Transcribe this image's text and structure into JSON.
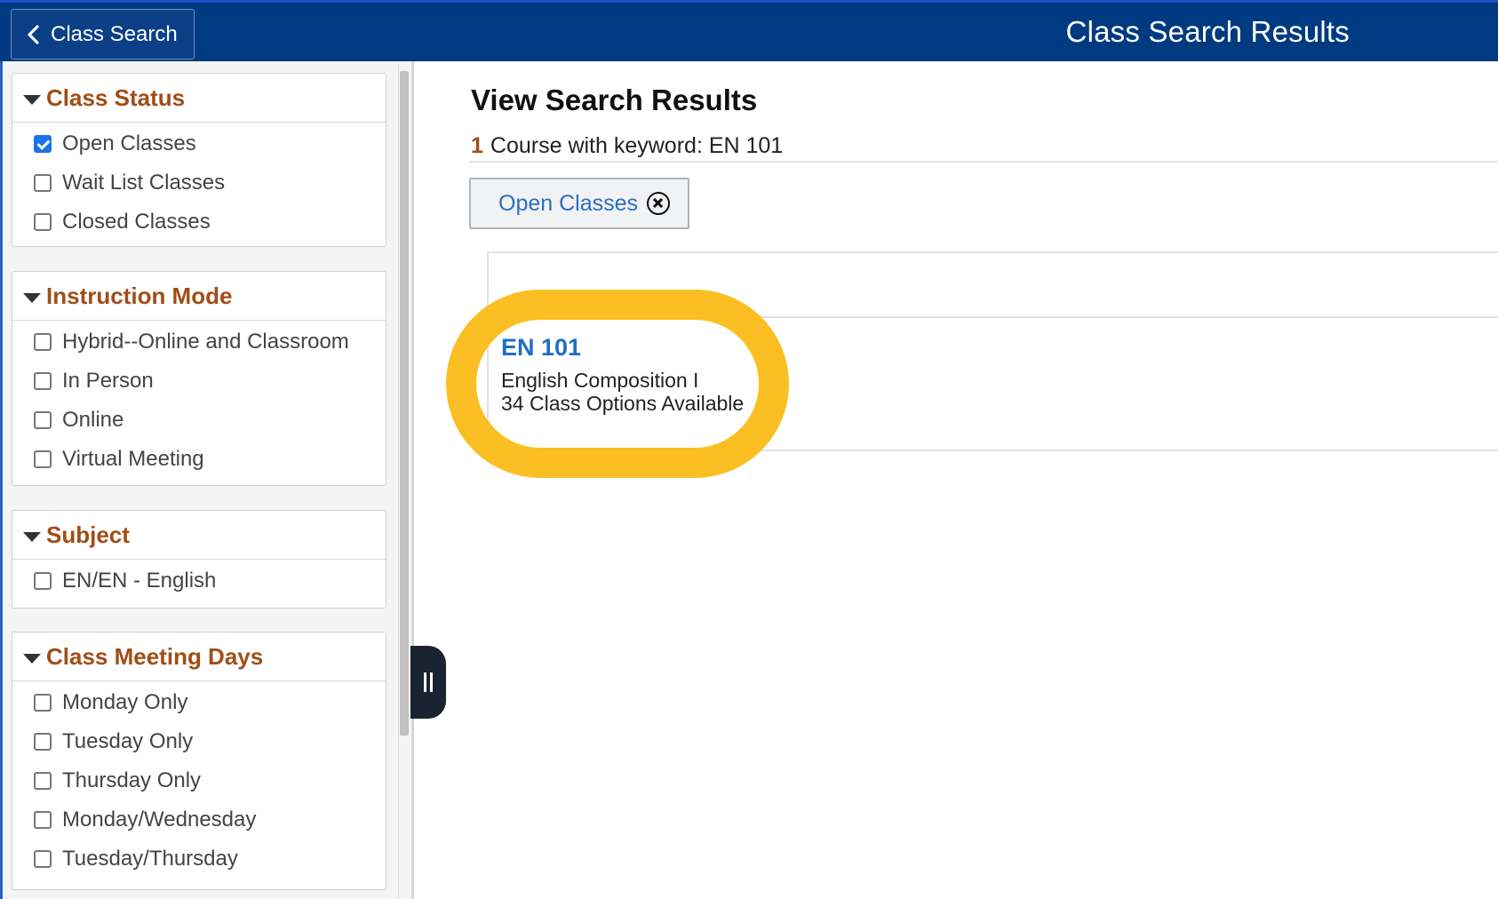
{
  "header": {
    "back_label": "Class Search",
    "title": "Class Search Results"
  },
  "sidebar": {
    "groups": [
      {
        "title": "Class Status",
        "options": [
          {
            "label": "Open Classes",
            "checked": true
          },
          {
            "label": "Wait List Classes",
            "checked": false
          },
          {
            "label": "Closed Classes",
            "checked": false
          }
        ]
      },
      {
        "title": "Instruction Mode",
        "options": [
          {
            "label": "Hybrid--Online and Classroom",
            "checked": false
          },
          {
            "label": "In Person",
            "checked": false
          },
          {
            "label": "Online",
            "checked": false
          },
          {
            "label": "Virtual Meeting",
            "checked": false
          }
        ]
      },
      {
        "title": "Subject",
        "options": [
          {
            "label": "EN/EN - English",
            "checked": false
          }
        ]
      },
      {
        "title": "Class Meeting Days",
        "options": [
          {
            "label": "Monday Only",
            "checked": false
          },
          {
            "label": "Tuesday Only",
            "checked": false
          },
          {
            "label": "Thursday Only",
            "checked": false
          },
          {
            "label": "Monday/Wednesday",
            "checked": false
          },
          {
            "label": "Tuesday/Thursday",
            "checked": false
          }
        ]
      }
    ]
  },
  "main": {
    "title": "View Search Results",
    "result_count": "1",
    "result_text": "Course with keyword: EN 101",
    "filter_chip": "Open Classes",
    "course": {
      "code": "EN 101",
      "name": "English Composition I",
      "options": "34 Class Options Available"
    }
  },
  "colors": {
    "header_bg": "#003a80",
    "accent_orange": "#a04e16",
    "link_blue": "#1f6fc4",
    "highlight": "#fbbf24"
  }
}
